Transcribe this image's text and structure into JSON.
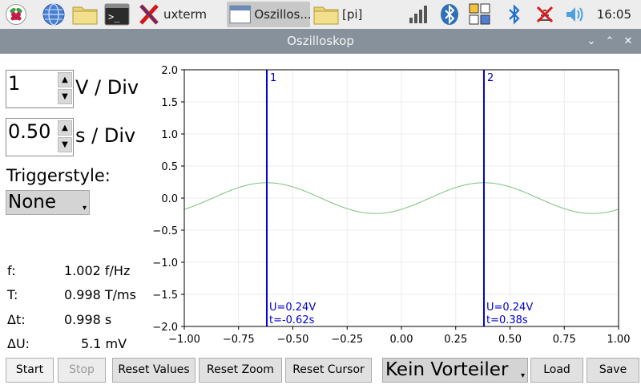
{
  "taskbar": {
    "tasks": [
      {
        "label": "uxterm"
      },
      {
        "label": "Oszillos..."
      },
      {
        "label": "[pi]"
      }
    ],
    "clock": "16:05"
  },
  "window": {
    "title": "Oszilloskop",
    "minimize_glyph": "⌄",
    "maximize_glyph": "⌃",
    "close_glyph": "✕"
  },
  "controls": {
    "volt_div_value": "1",
    "volt_div_unit": "V / Div",
    "time_div_value": "0.50",
    "time_div_unit": "s / Div",
    "trigger_label": "Triggerstyle:",
    "trigger_value": "None"
  },
  "measurements": [
    {
      "label": "f:",
      "value": "1.002 f/Hz"
    },
    {
      "label": "T:",
      "value": "0.998 T/ms"
    },
    {
      "label": "Δt:",
      "value": "0.998 s"
    },
    {
      "label": "ΔU:",
      "value": "5.1 mV"
    }
  ],
  "buttons": {
    "start": "Start",
    "stop": "Stop",
    "reset_values": "Reset Values",
    "reset_zoom": "Reset Zoom",
    "reset_cursor": "Reset Cursor",
    "divider_value": "Kein Vorteiler",
    "load": "Load",
    "save": "Save"
  },
  "chart_data": {
    "type": "line",
    "xlim": [
      -1.0,
      1.0
    ],
    "ylim": [
      -2.0,
      2.0
    ],
    "x_ticks": [
      "−1.00",
      "−0.75",
      "−0.50",
      "−0.25",
      "0.00",
      "0.25",
      "0.50",
      "0.75",
      "1.00"
    ],
    "y_ticks": [
      "2.0",
      "1.5",
      "1.0",
      "0.5",
      "0.0",
      "−0.5",
      "−1.0",
      "−1.5",
      "−2.0"
    ],
    "grid": true,
    "series": [
      {
        "amplitude": 0.24,
        "frequency_hz": 1.0,
        "phase_peak_x": -0.62,
        "color": "#7cc27c"
      }
    ],
    "cursors": [
      {
        "id": "1",
        "x": -0.62,
        "label_u": "U=0.24V",
        "label_t": "t=-0.62s",
        "color": "#0000d0"
      },
      {
        "id": "2",
        "x": 0.38,
        "label_u": "U=0.24V",
        "label_t": "t=0.38s",
        "color": "#0000d0"
      }
    ]
  }
}
